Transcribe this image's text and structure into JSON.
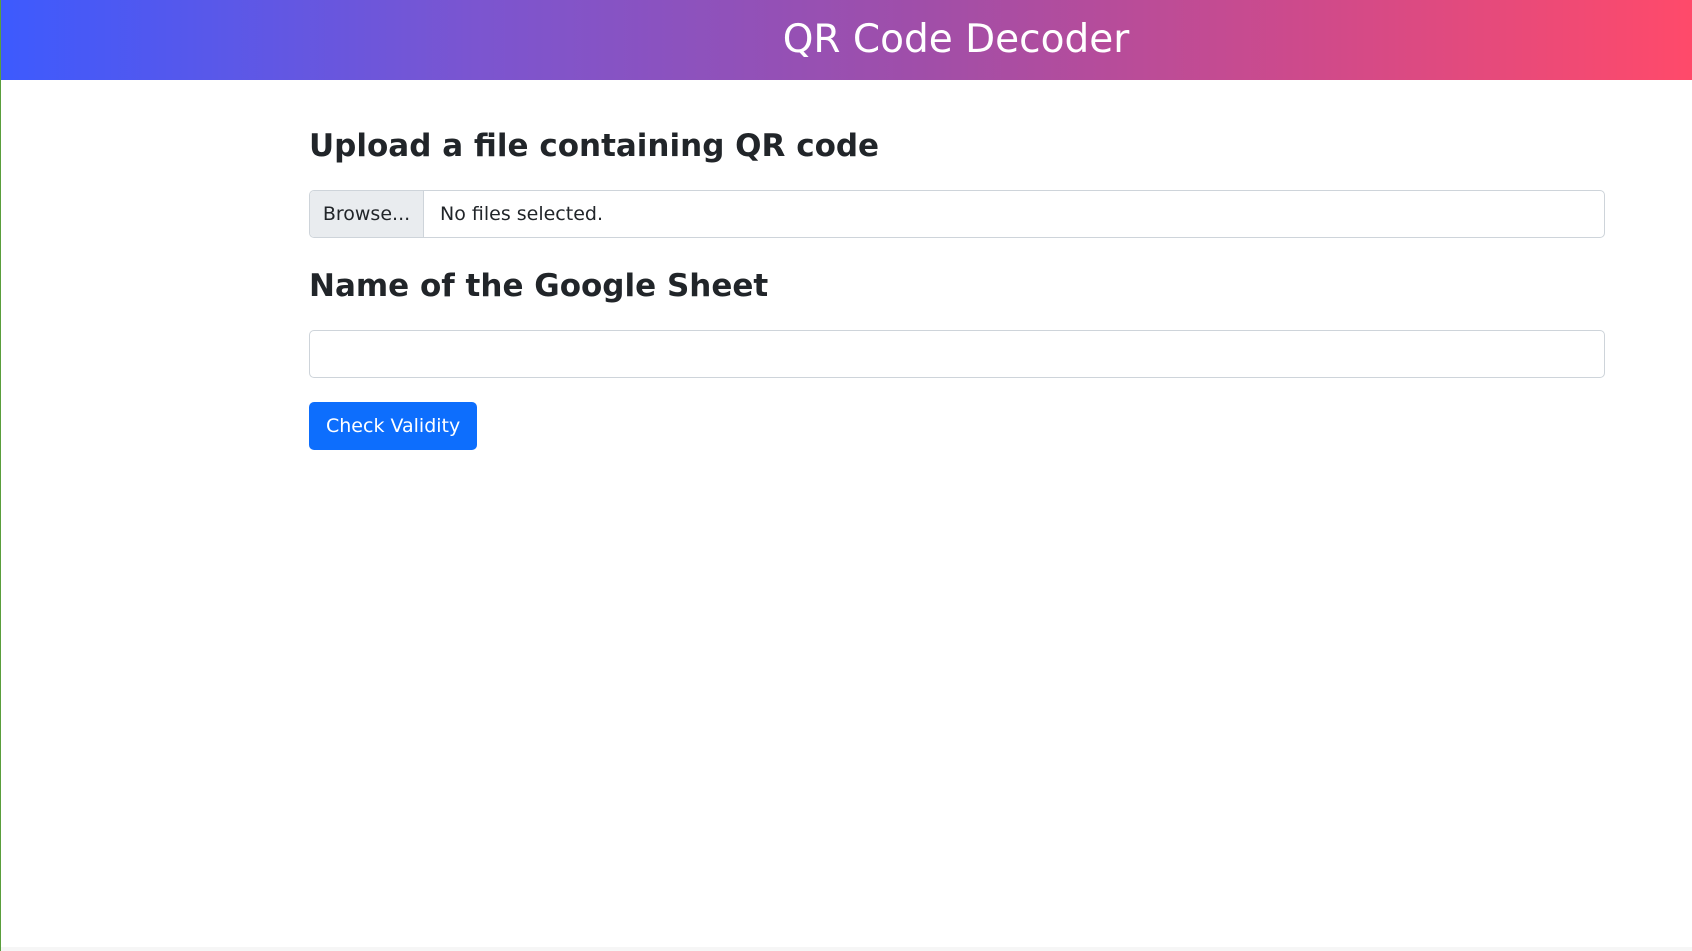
{
  "header": {
    "title": "QR Code Decoder"
  },
  "upload": {
    "heading": "Upload a file containing QR code",
    "browse_label": "Browse...",
    "status": "No files selected."
  },
  "sheet": {
    "heading": "Name of the Google Sheet",
    "value": "",
    "placeholder": ""
  },
  "actions": {
    "check_label": "Check Validity"
  },
  "colors": {
    "header_gradient_start": "#3d5afe",
    "header_gradient_end": "#ff4a6a",
    "primary_button": "#0d6efd"
  }
}
